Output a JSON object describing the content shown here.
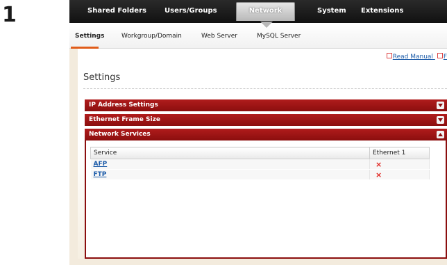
{
  "step": "1",
  "topnav": {
    "items": [
      "Shared Folders",
      "Users/Groups",
      "Network",
      "System",
      "Extensions"
    ],
    "active": "Network"
  },
  "subnav": {
    "items": [
      "Settings",
      "Workgroup/Domain",
      "Web Server",
      "MySQL Server"
    ],
    "active": "Settings"
  },
  "header": {
    "manual_link": "Read Manual",
    "title": "Settings"
  },
  "sections": [
    {
      "label": "IP Address Settings",
      "state": "collapsed"
    },
    {
      "label": "Ethernet Frame Size",
      "state": "collapsed"
    },
    {
      "label": "Network Services",
      "state": "expanded"
    }
  ],
  "services_table": {
    "columns": [
      "Service",
      "Ethernet 1"
    ],
    "rows": [
      {
        "service": "AFP",
        "ethernet1": "×"
      },
      {
        "service": "FTP",
        "ethernet1": "×"
      }
    ]
  },
  "colors": {
    "section_bar": "#8b0e0e",
    "accent": "#e05c1a",
    "link": "#1a5aa8",
    "status_off": "#e0201b"
  }
}
